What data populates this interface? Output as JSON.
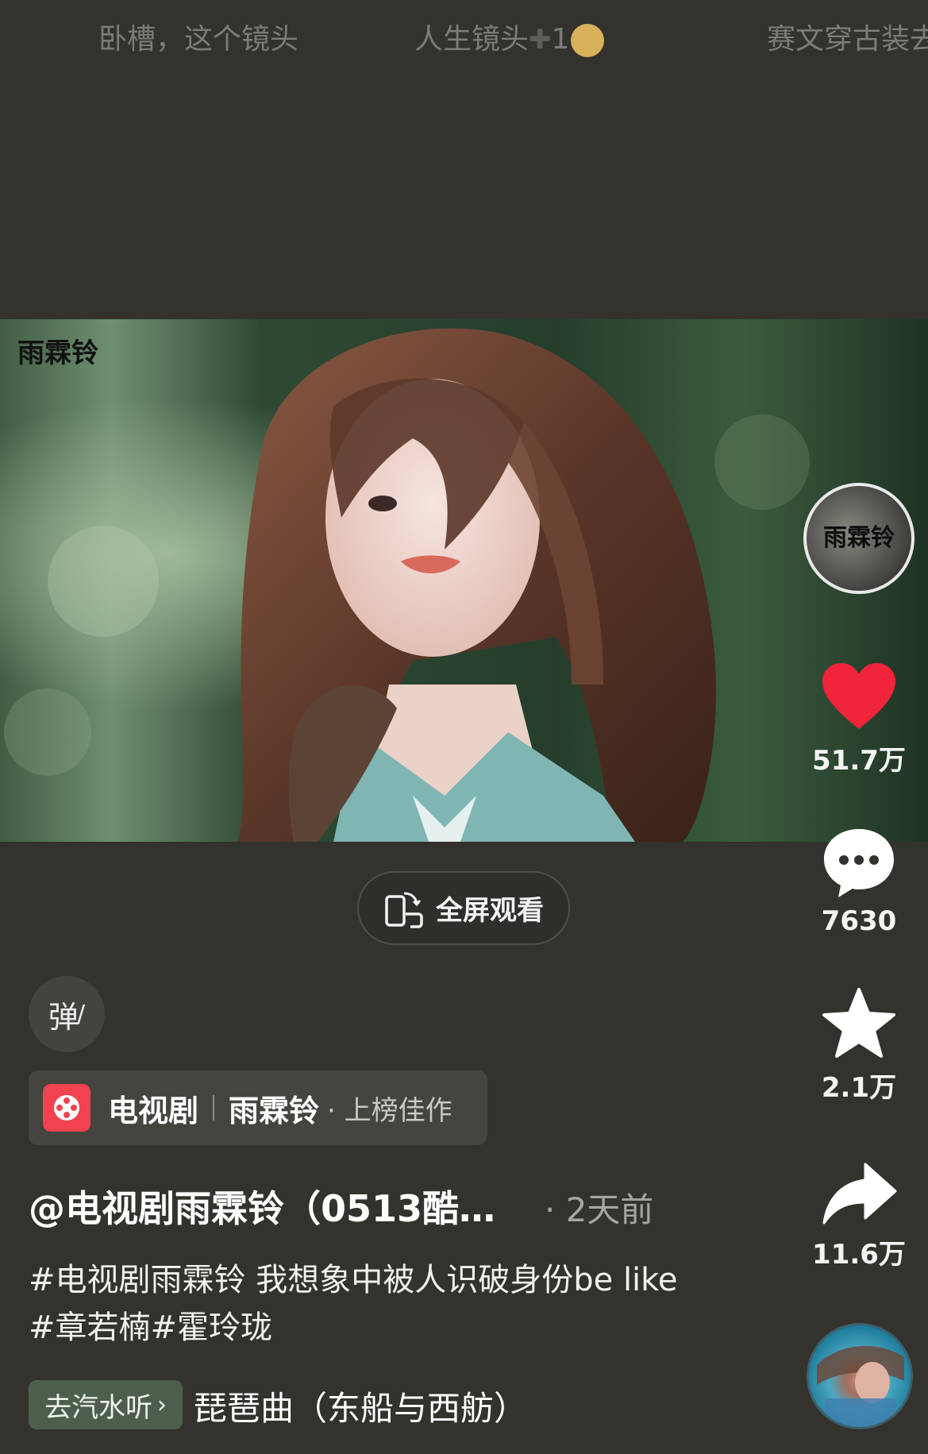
{
  "top_tabs": [
    {
      "label": "卧槽，这个镜头"
    },
    {
      "label": "人生镜头",
      "suffix": "1"
    },
    {
      "label": "赛文穿古装去"
    }
  ],
  "video": {
    "watermark": "雨霖铃"
  },
  "fullscreen_button": {
    "label": "全屏观看"
  },
  "danmaku_button": {
    "label": "弹"
  },
  "category_tag": {
    "type": "电视剧",
    "title": "雨霖铃",
    "rank": "· 上榜佳作"
  },
  "post": {
    "author": "@电视剧雨霖铃（0513酷…",
    "time": "· 2天前",
    "description": "#电视剧雨霖铃 我想象中被人识破身份be like #章若楠#霍玲珑"
  },
  "music": {
    "button_label": "去汽水听",
    "title": "琵琶曲（东船与西舫）"
  },
  "actions": {
    "avatar_text": "雨霖铃",
    "likes": "51.7万",
    "comments": "7630",
    "favorites": "2.1万",
    "shares": "11.6万"
  },
  "colors": {
    "background": "#33322d",
    "like_red": "#f0243b",
    "category_icon_red": "#f0424f",
    "music_button_green": "#4d5f4c"
  }
}
